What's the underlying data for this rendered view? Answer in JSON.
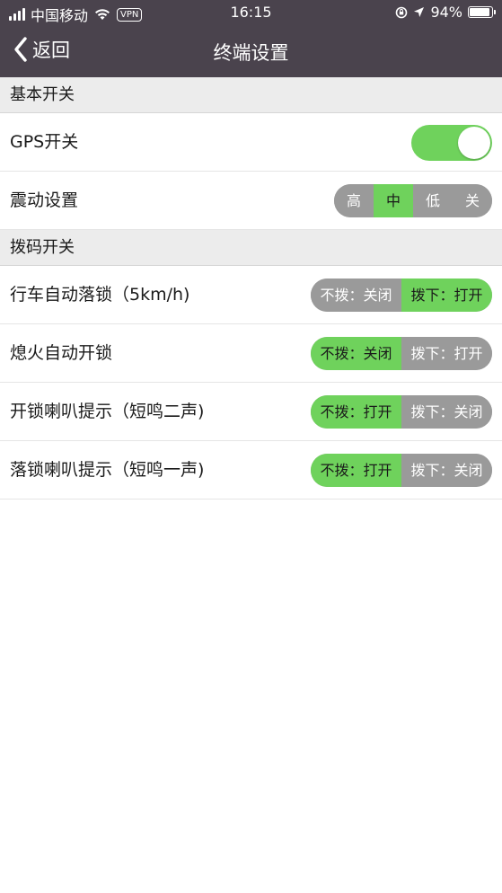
{
  "status_bar": {
    "carrier": "中国移动",
    "vpn": "VPN",
    "time": "16:15",
    "battery": "94%"
  },
  "nav": {
    "back_label": "返回",
    "title": "终端设置"
  },
  "sections": {
    "basic": "基本开关",
    "dip": "拨码开关"
  },
  "gps": {
    "label": "GPS开关",
    "on": true
  },
  "vibration": {
    "label": "震动设置",
    "options": [
      "高",
      "中",
      "低",
      "关"
    ],
    "selected": "中"
  },
  "dip_rows": [
    {
      "label": "行车自动落锁（5km/h)",
      "left": "不拨：关闭",
      "right": "拨下：打开",
      "active": "right"
    },
    {
      "label": "熄火自动开锁",
      "left": "不拨：关闭",
      "right": "拨下：打开",
      "active": "left"
    },
    {
      "label": "开锁喇叭提示（短鸣二声)",
      "left": "不拨：打开",
      "right": "拨下：关闭",
      "active": "left"
    },
    {
      "label": "落锁喇叭提示（短鸣一声)",
      "left": "不拨：打开",
      "right": "拨下：关闭",
      "active": "left"
    }
  ],
  "colors": {
    "nav_bg": "#4a434d",
    "accent_green": "#6fd25c",
    "inactive_gray": "#9a9a9a"
  }
}
